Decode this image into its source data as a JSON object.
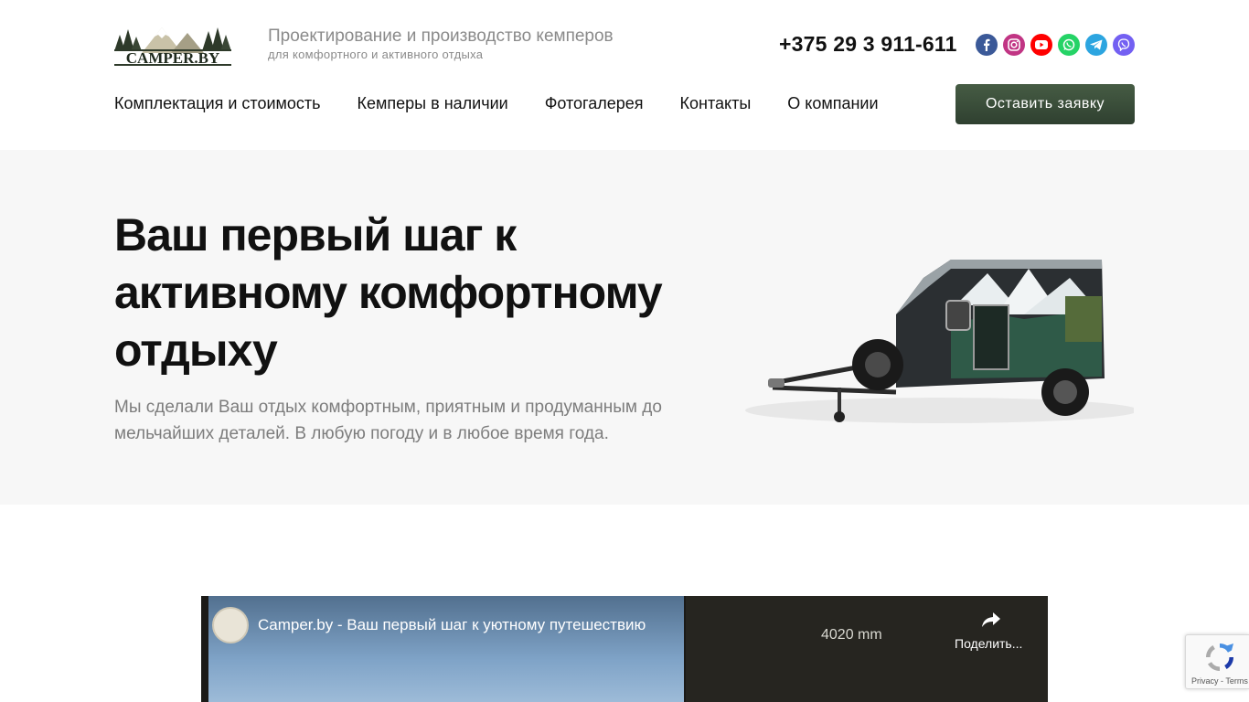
{
  "header": {
    "logo_text": "CAMPER.BY",
    "tagline": "Проектирование и производство кемперов",
    "subtagline": "для комфортного и активного отдыха",
    "phone": "+375 29 3 911-611",
    "socials": [
      {
        "name": "facebook-icon",
        "color": "#3b5998"
      },
      {
        "name": "instagram-icon",
        "color": "#c13584"
      },
      {
        "name": "youtube-icon",
        "color": "#ff0000"
      },
      {
        "name": "whatsapp-icon",
        "color": "#25d366"
      },
      {
        "name": "telegram-icon",
        "color": "#2ca5e0"
      },
      {
        "name": "viber-icon",
        "color": "#7360f2"
      }
    ]
  },
  "nav": {
    "items": [
      {
        "label": "Комплектация и стоимость"
      },
      {
        "label": "Кемперы в наличии"
      },
      {
        "label": "Фотогалерея"
      },
      {
        "label": "Контакты"
      },
      {
        "label": "О компании"
      }
    ],
    "cta_label": "Оставить заявку"
  },
  "hero": {
    "title": "Ваш первый шаг к активному комфортному отдыху",
    "text": "Мы сделали Ваш отдых комфортным, приятным и продуманным до мельчайших деталей. В любую погоду и в любое время года."
  },
  "video": {
    "title": "Camper.by - Ваш первый шаг к уютному путешествию",
    "dimension_label": "4020 mm",
    "share_label": "Поделить..."
  },
  "recaptcha": {
    "links": "Privacy - Terms"
  },
  "colors": {
    "accent": "#3c4f3b",
    "hero_bg": "#f7f7f7",
    "muted_text": "#7d7d7d"
  }
}
